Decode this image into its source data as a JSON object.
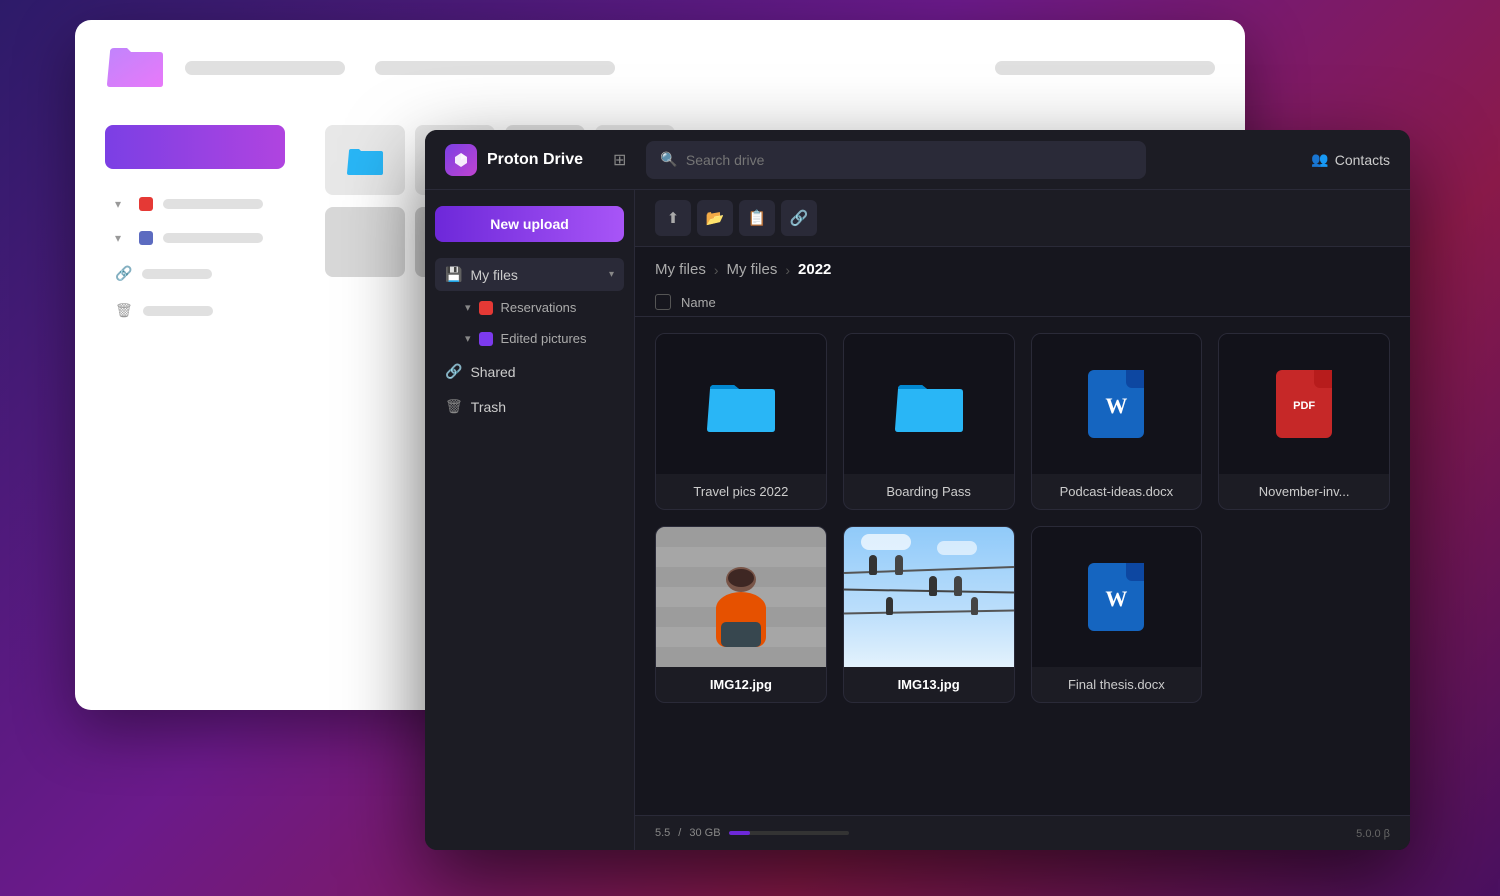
{
  "background": {
    "gradient_start": "#2d1b69",
    "gradient_end": "#8b1a4a"
  },
  "bg_window": {
    "visible": true
  },
  "app": {
    "name": "Proton Drive",
    "search_placeholder": "Search drive"
  },
  "header": {
    "logo_alt": "Proton Drive logo",
    "app_name_label": "Proton Drive",
    "search_placeholder": "Search drive",
    "contacts_label": "Contacts"
  },
  "sidebar": {
    "new_upload_label": "New upload",
    "my_files_label": "My files",
    "reservations_label": "Reservations",
    "edited_pictures_label": "Edited pictures",
    "shared_label": "Shared",
    "trash_label": "Trash"
  },
  "toolbar": {
    "upload_file_title": "Upload file",
    "upload_folder_title": "Upload folder",
    "new_folder_title": "New folder",
    "get_link_title": "Get link"
  },
  "breadcrumb": {
    "items": [
      {
        "label": "My files",
        "active": false
      },
      {
        "label": "My files",
        "active": false
      },
      {
        "label": "2022",
        "active": true
      }
    ]
  },
  "columns": {
    "name_label": "Name"
  },
  "files": [
    {
      "id": "travel-pics",
      "name": "Travel pics 2022",
      "type": "folder",
      "icon": "folder-blue",
      "bold": false
    },
    {
      "id": "boarding-pass",
      "name": "Boarding Pass",
      "type": "folder",
      "icon": "folder-blue",
      "bold": false
    },
    {
      "id": "podcast-ideas",
      "name": "Podcast-ideas.docx",
      "type": "docx",
      "icon": "word",
      "bold": false
    },
    {
      "id": "november-inv",
      "name": "November-inv...",
      "type": "pdf",
      "icon": "pdf",
      "bold": false,
      "partial": true
    },
    {
      "id": "img12",
      "name": "IMG12.jpg",
      "type": "image",
      "icon": "photo-sitting",
      "bold": true
    },
    {
      "id": "img13",
      "name": "IMG13.jpg",
      "type": "image",
      "icon": "photo-cables",
      "bold": true
    },
    {
      "id": "final-thesis",
      "name": "Final thesis.docx",
      "type": "docx",
      "icon": "word",
      "bold": false
    }
  ],
  "status_bar": {
    "used_storage": "5.5",
    "total_storage": "30 GB",
    "right_label": "5.0.0 β"
  },
  "icons": {
    "search": "🔍",
    "grid": "⊞",
    "contacts": "👥",
    "upload_file": "⬆",
    "upload_folder": "📁",
    "new_folder": "📋",
    "link": "🔗",
    "shared": "🔗",
    "trash": "🗑",
    "chevron_down": "▾",
    "chevron_right": "›",
    "separator": "›"
  }
}
